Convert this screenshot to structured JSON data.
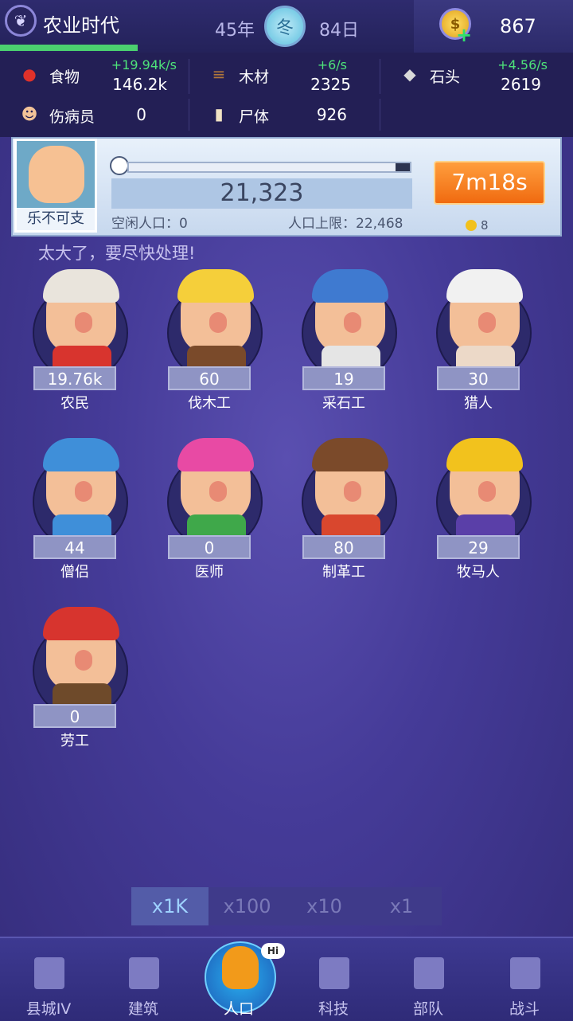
{
  "header": {
    "era_title": "农业时代",
    "era_progress": 0.24,
    "year": "45年",
    "season": "冬",
    "day": "84日",
    "coins": "867"
  },
  "resources": [
    {
      "id": "food",
      "label": "食物",
      "rate": "+19.94k/s",
      "value": "146.2k",
      "icon": "apple-icon"
    },
    {
      "id": "wood",
      "label": "木材",
      "rate": "+6/s",
      "value": "2325",
      "icon": "log-icon"
    },
    {
      "id": "stone",
      "label": "石头",
      "rate": "+4.56/s",
      "value": "2619",
      "icon": "stone-icon"
    },
    {
      "id": "wounded",
      "label": "伤病员",
      "rate": "",
      "value": "0",
      "icon": "wounded-icon"
    },
    {
      "id": "corpse",
      "label": "尸体",
      "rate": "",
      "value": "926",
      "icon": "coffin-icon"
    }
  ],
  "population": {
    "leader_name": "乐不可支",
    "total": "21,323",
    "idle": "空闲人口：0",
    "cap": "人口上限：22,468",
    "timer": "7m18s",
    "timer_cost": "8",
    "progress": 0.95
  },
  "notice": "太大了，要尽快处理!",
  "workers": [
    {
      "name": "农民",
      "count": "19.76k",
      "hair": "#e9e4dc",
      "body": "#d8342e"
    },
    {
      "name": "伐木工",
      "count": "60",
      "hair": "#f5cf3a",
      "body": "#7a4a2a"
    },
    {
      "name": "采石工",
      "count": "19",
      "hair": "#3f7ad0",
      "body": "#e5e5e5"
    },
    {
      "name": "猎人",
      "count": "30",
      "hair": "#f1f1f1",
      "body": "#ecd9c8"
    },
    {
      "name": "僧侣",
      "count": "44",
      "hair": "#3f8fd9",
      "body": "#3f8fd9"
    },
    {
      "name": "医师",
      "count": "0",
      "hair": "#e84aa4",
      "body": "#3fa84a"
    },
    {
      "name": "制革工",
      "count": "80",
      "hair": "#7b4a2a",
      "body": "#d9472e"
    },
    {
      "name": "牧马人",
      "count": "29",
      "hair": "#f2c21d",
      "body": "#5a3fa8"
    },
    {
      "name": "劳工",
      "count": "0",
      "hair": "#d7342e",
      "body": "#6e4a2a"
    }
  ],
  "multipliers": [
    {
      "label": "x1K",
      "active": true
    },
    {
      "label": "x100",
      "active": false
    },
    {
      "label": "x10",
      "active": false
    },
    {
      "label": "x1",
      "active": false
    }
  ],
  "nav": [
    {
      "label": "县城IV",
      "icon": "castle-icon",
      "active": false
    },
    {
      "label": "建筑",
      "icon": "house-icon",
      "active": false
    },
    {
      "label": "人口",
      "icon": "people-icon",
      "active": true,
      "bubble": "Hi"
    },
    {
      "label": "科技",
      "icon": "book-icon",
      "active": false
    },
    {
      "label": "部队",
      "icon": "banner-icon",
      "active": false
    },
    {
      "label": "战斗",
      "icon": "swords-icon",
      "active": false
    }
  ],
  "colors": {
    "accent_green": "#4ee37a",
    "timer_orange": "#f06a10",
    "background": "#453b98"
  }
}
